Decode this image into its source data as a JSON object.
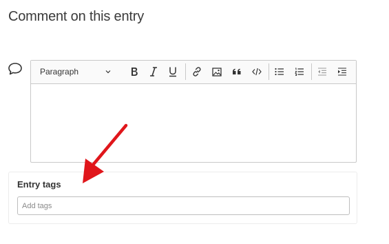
{
  "page": {
    "title": "Comment on this entry"
  },
  "editor": {
    "block_format_value": "Paragraph",
    "toolbar_icons": [
      "bold-icon",
      "italic-icon",
      "underline-icon",
      "link-icon",
      "image-icon",
      "blockquote-icon",
      "code-icon",
      "bulleted-list-icon",
      "numbered-list-icon",
      "outdent-icon",
      "indent-icon"
    ],
    "body_text": ""
  },
  "tags": {
    "label": "Entry tags",
    "placeholder": "Add tags",
    "value": ""
  },
  "annotation": {
    "arrow_color": "#e0161b"
  }
}
